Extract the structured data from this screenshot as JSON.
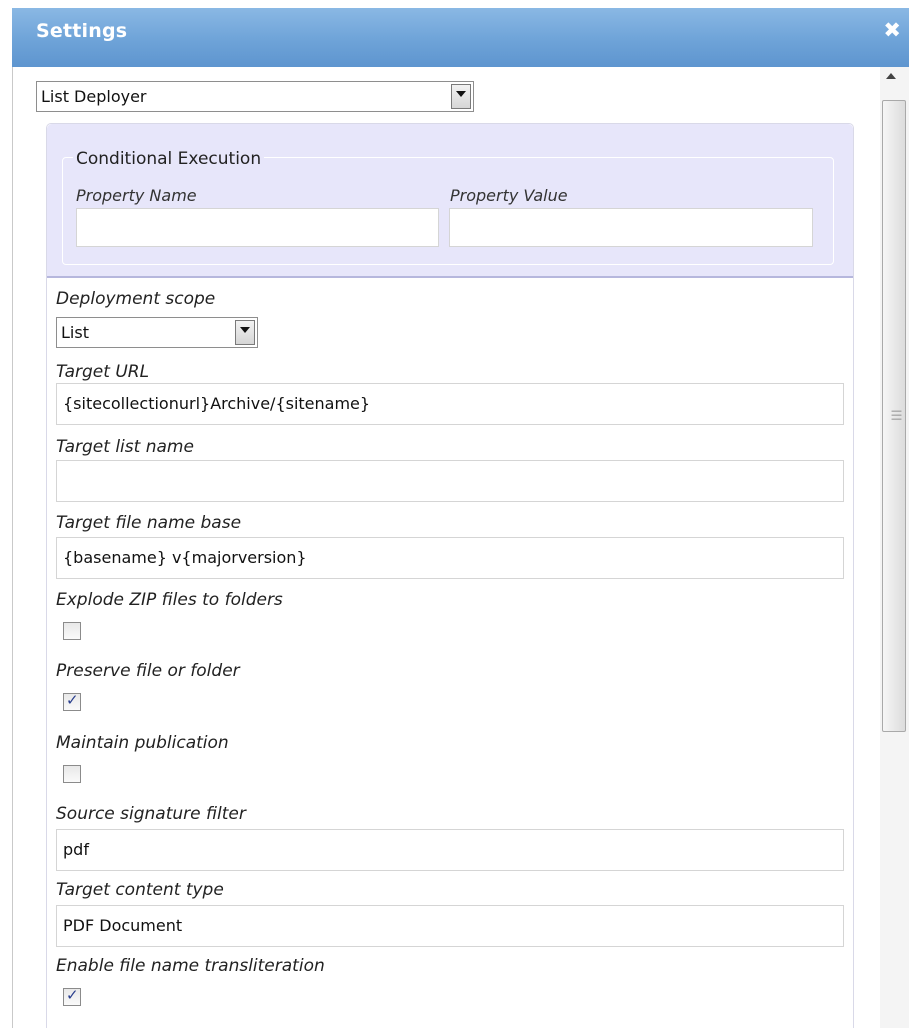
{
  "dialog": {
    "title": "Settings"
  },
  "deployer_select": {
    "value": "List Deployer"
  },
  "conditional": {
    "legend": "Conditional Execution",
    "property_name_label": "Property Name",
    "property_value_label": "Property Value",
    "property_name_value": "",
    "property_value_value": ""
  },
  "fields": {
    "deployment_scope": {
      "label": "Deployment scope",
      "value": "List"
    },
    "target_url": {
      "label": "Target URL",
      "value": "{sitecollectionurl}Archive/{sitename}"
    },
    "target_list_name": {
      "label": "Target list name",
      "value": ""
    },
    "target_file_name_base": {
      "label": "Target file name base",
      "value": "{basename} v{majorversion}"
    },
    "explode_zip": {
      "label": "Explode ZIP files to folders",
      "checked": false
    },
    "preserve_file": {
      "label": "Preserve file or folder",
      "checked": true
    },
    "maintain_publication": {
      "label": "Maintain publication",
      "checked": false
    },
    "source_signature_filter": {
      "label": "Source signature filter",
      "value": "pdf"
    },
    "target_content_type": {
      "label": "Target content type",
      "value": "PDF Document"
    },
    "enable_transliteration": {
      "label": "Enable file name transliteration",
      "checked": true
    }
  },
  "icons": {
    "close": "close-icon",
    "check": "checkmark-icon",
    "dropdown": "chevron-down-icon"
  },
  "colors": {
    "titlebar": "#6ea3d8",
    "conditional_bg": "#e7e6fa",
    "checkmark": "#2a3f8e"
  }
}
